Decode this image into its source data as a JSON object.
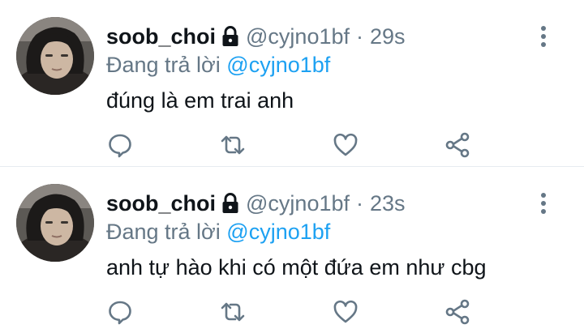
{
  "tweets": [
    {
      "name": "soob_choi",
      "handle": "@cyjno1bf",
      "separator": "·",
      "time": "29s",
      "reply_prefix": "Đang trả lời",
      "reply_to": "@cyjno1bf",
      "text": "đúng là em trai anh"
    },
    {
      "name": "soob_choi",
      "handle": "@cyjno1bf",
      "separator": "·",
      "time": "23s",
      "reply_prefix": "Đang trả lời",
      "reply_to": "@cyjno1bf",
      "text": "anh tự hào khi có một đứa em như cbg"
    }
  ],
  "icons": {
    "lock": "lock-icon",
    "more": "more-vertical-icon",
    "reply": "reply-icon",
    "retweet": "retweet-icon",
    "like": "heart-icon",
    "share": "share-icon"
  },
  "colors": {
    "text": "#0f1419",
    "secondary": "#657786",
    "link": "#1da1f2",
    "divider": "#e6ecf0"
  }
}
